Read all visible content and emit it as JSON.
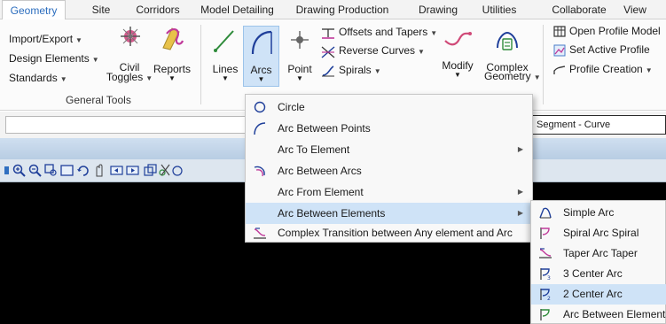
{
  "tabs": [
    {
      "label": "Geometry",
      "active": true
    },
    {
      "label": "Site"
    },
    {
      "label": "Corridors"
    },
    {
      "label": "Model Detailing"
    },
    {
      "label": "Drawing Production"
    },
    {
      "label": "Drawing"
    },
    {
      "label": "Utilities"
    },
    {
      "label": "Collaborate"
    },
    {
      "label": "View"
    }
  ],
  "general_tools": {
    "import_export": "Import/Export",
    "design_elements": "Design Elements",
    "standards": "Standards",
    "civil_toggles_l1": "Civil",
    "civil_toggles_l2": "Toggles",
    "reports": "Reports",
    "group_label": "General Tools"
  },
  "horizontal": {
    "lines": "Lines",
    "arcs": "Arcs",
    "point": "Point",
    "offsets_tapers": "Offsets and Tapers",
    "reverse_curves": "Reverse Curves",
    "spirals": "Spirals",
    "modify": "Modify",
    "complex_l1": "Complex",
    "complex_l2": "Geometry"
  },
  "vertical": {
    "open_profile_model": "Open Profile Model",
    "set_active_profile": "Set Active Profile",
    "profile_creation": "Profile Creation"
  },
  "command_bar": {
    "segment_value": "Segment - Curve"
  },
  "arcs_menu": [
    {
      "label": "Circle",
      "icon": "circle-icon",
      "submenu": false
    },
    {
      "label": "Arc Between Points",
      "icon": "arc-between-points-icon",
      "submenu": false
    },
    {
      "label": "Arc To Element",
      "icon": "",
      "submenu": true
    },
    {
      "label": "Arc Between Arcs",
      "icon": "arc-between-arcs-icon",
      "submenu": false
    },
    {
      "label": "Arc From Element",
      "icon": "",
      "submenu": true
    },
    {
      "label": "Arc Between Elements",
      "icon": "",
      "submenu": true,
      "highlighted": true
    },
    {
      "label": "Complex Transition between Any element and Arc",
      "icon": "complex-transition-icon",
      "submenu": false
    }
  ],
  "arc_between_elements_submenu": [
    {
      "label": "Simple Arc",
      "icon": "simple-arc-icon"
    },
    {
      "label": "Spiral Arc Spiral",
      "icon": "spiral-arc-spiral-icon"
    },
    {
      "label": "Taper Arc Taper",
      "icon": "taper-arc-taper-icon"
    },
    {
      "label": "3 Center Arc",
      "icon": "three-center-arc-icon"
    },
    {
      "label": "2 Center Arc",
      "icon": "two-center-arc-icon",
      "highlighted": true
    },
    {
      "label": "Arc Between Elements",
      "icon": "arc-between-elements-icon"
    }
  ],
  "colors": {
    "accent": "#2b6dbe",
    "highlight": "#cfe3f7",
    "canvas": "#000000"
  }
}
